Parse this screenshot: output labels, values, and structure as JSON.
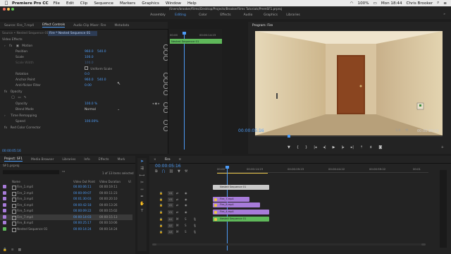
{
  "menubar": {
    "app": "Premiere Pro CC",
    "items": [
      "File",
      "Edit",
      "Clip",
      "Sequence",
      "Markers",
      "Graphics",
      "Window",
      "Help"
    ],
    "battery": "100%",
    "time": "Mon 18:44",
    "user": "Chris Brooker"
  },
  "path": "/Users/brooker/Films/Desktop/Projects/BrookerFilms Tutorials/PremSF1.prproj",
  "workspaces": [
    "Assembly",
    "Editing",
    "Color",
    "Effects",
    "Audio",
    "Graphics",
    "Libraries"
  ],
  "workspace_active": "Editing",
  "left_panel": {
    "tabs": [
      "Source: Fire_7.mp4",
      "Effect Controls",
      "Audio Clip Mixer: Fire",
      "Metadata"
    ],
    "active_tab": "Effect Controls",
    "source_label": "Source • Nested Sequence 01",
    "seq_label": "Fire * Nested Sequence 01",
    "video_effects": "Video Effects",
    "motion": "Motion",
    "params": [
      {
        "name": "Position",
        "v1": "960.0",
        "v2": "540.0"
      },
      {
        "name": "Scale",
        "v1": "100.0",
        "v2": ""
      },
      {
        "name": "Scale Width",
        "v1": "100.0",
        "v2": ""
      },
      {
        "name": "",
        "v1": "Uniform Scale",
        "v2": ""
      },
      {
        "name": "Rotation",
        "v1": "0.0",
        "v2": ""
      },
      {
        "name": "Anchor Point",
        "v1": "960.0",
        "v2": "540.0"
      },
      {
        "name": "Anti-flicker Filter",
        "v1": "0.00",
        "v2": ""
      }
    ],
    "opacity": "Opacity",
    "opacity_value": "100.0 %",
    "opacity_label": "Opacity",
    "blend_mode_label": "Blend Mode",
    "blend_mode": "Normal",
    "time_remapping": "Time Remapping",
    "speed_label": "Speed",
    "speed_value": "100.00%",
    "red_color": "Red Color Corrector",
    "timecode": "00:00:05:16",
    "mini_times": [
      "00:00",
      "00:00:14:23"
    ],
    "mini_clip": "Nested Sequence 01"
  },
  "program": {
    "title": "Program: Fire",
    "timecode": "00:00:05:16",
    "fit": "Fit",
    "fraction": "1/4",
    "duration": "00:00:20:10"
  },
  "project": {
    "tabs": [
      "Project: SF1",
      "Media Browser",
      "Libraries",
      "Info",
      "Effects",
      "Mark"
    ],
    "file": "SF1.prproj",
    "selected": "1 of 13 items selected",
    "headers": [
      "Name",
      "Video Out Point",
      "Video Duration",
      "Vi"
    ],
    "rows": [
      {
        "name": "Fire_1.mp4",
        "out": "00:00:06:11",
        "dur": "00:00:19:11",
        "color": "#a77bd9"
      },
      {
        "name": "Fire_2.mp4",
        "out": "00:00:09:07",
        "dur": "00:00:11:23",
        "color": "#a77bd9"
      },
      {
        "name": "Fire_3.mp4",
        "out": "00:01:30:03",
        "dur": "00:00:20:10",
        "color": "#a77bd9"
      },
      {
        "name": "Fire_4.mp4",
        "out": "00:00:42:18",
        "dur": "00:00:13:26",
        "color": "#a77bd9"
      },
      {
        "name": "Fire_5.mp4",
        "out": "00:00:09:22",
        "dur": "00:00:15:02",
        "color": "#a77bd9"
      },
      {
        "name": "Fire_7.mp4",
        "out": "00:00:14:03",
        "dur": "00:00:15:13",
        "color": "#a77bd9"
      },
      {
        "name": "Fire_8.mp4",
        "out": "00:00:25:17",
        "dur": "00:00:10:06",
        "color": "#a77bd9"
      },
      {
        "name": "Nested Sequence 01",
        "out": "00:00:14:24",
        "dur": "00:00:14:24",
        "color": "#5fb85a"
      }
    ]
  },
  "timeline": {
    "seq_name": "Fire",
    "timecode": "00:00:05:16",
    "ruler": [
      "00:00",
      "00:00:14:23",
      "00:00:29:23",
      "00:00:44:22",
      "00:00:59:22",
      "00:01"
    ],
    "tracks": [
      "V4",
      "V3",
      "V2",
      "V1",
      "A1",
      "A2",
      "A3"
    ],
    "clips": {
      "v4": "Nested Sequence 01",
      "v3": "Fire_7.mp4",
      "v2a": "Fire_8.mp4",
      "v2b": "Fire_4.mp4",
      "a1": "Nested Sequence 01"
    }
  },
  "colors": {
    "accent": "#4d9bf5",
    "video_clip": "#a77bd9",
    "audio_clip": "#5fb85a",
    "nested": "#c9c9c9"
  }
}
